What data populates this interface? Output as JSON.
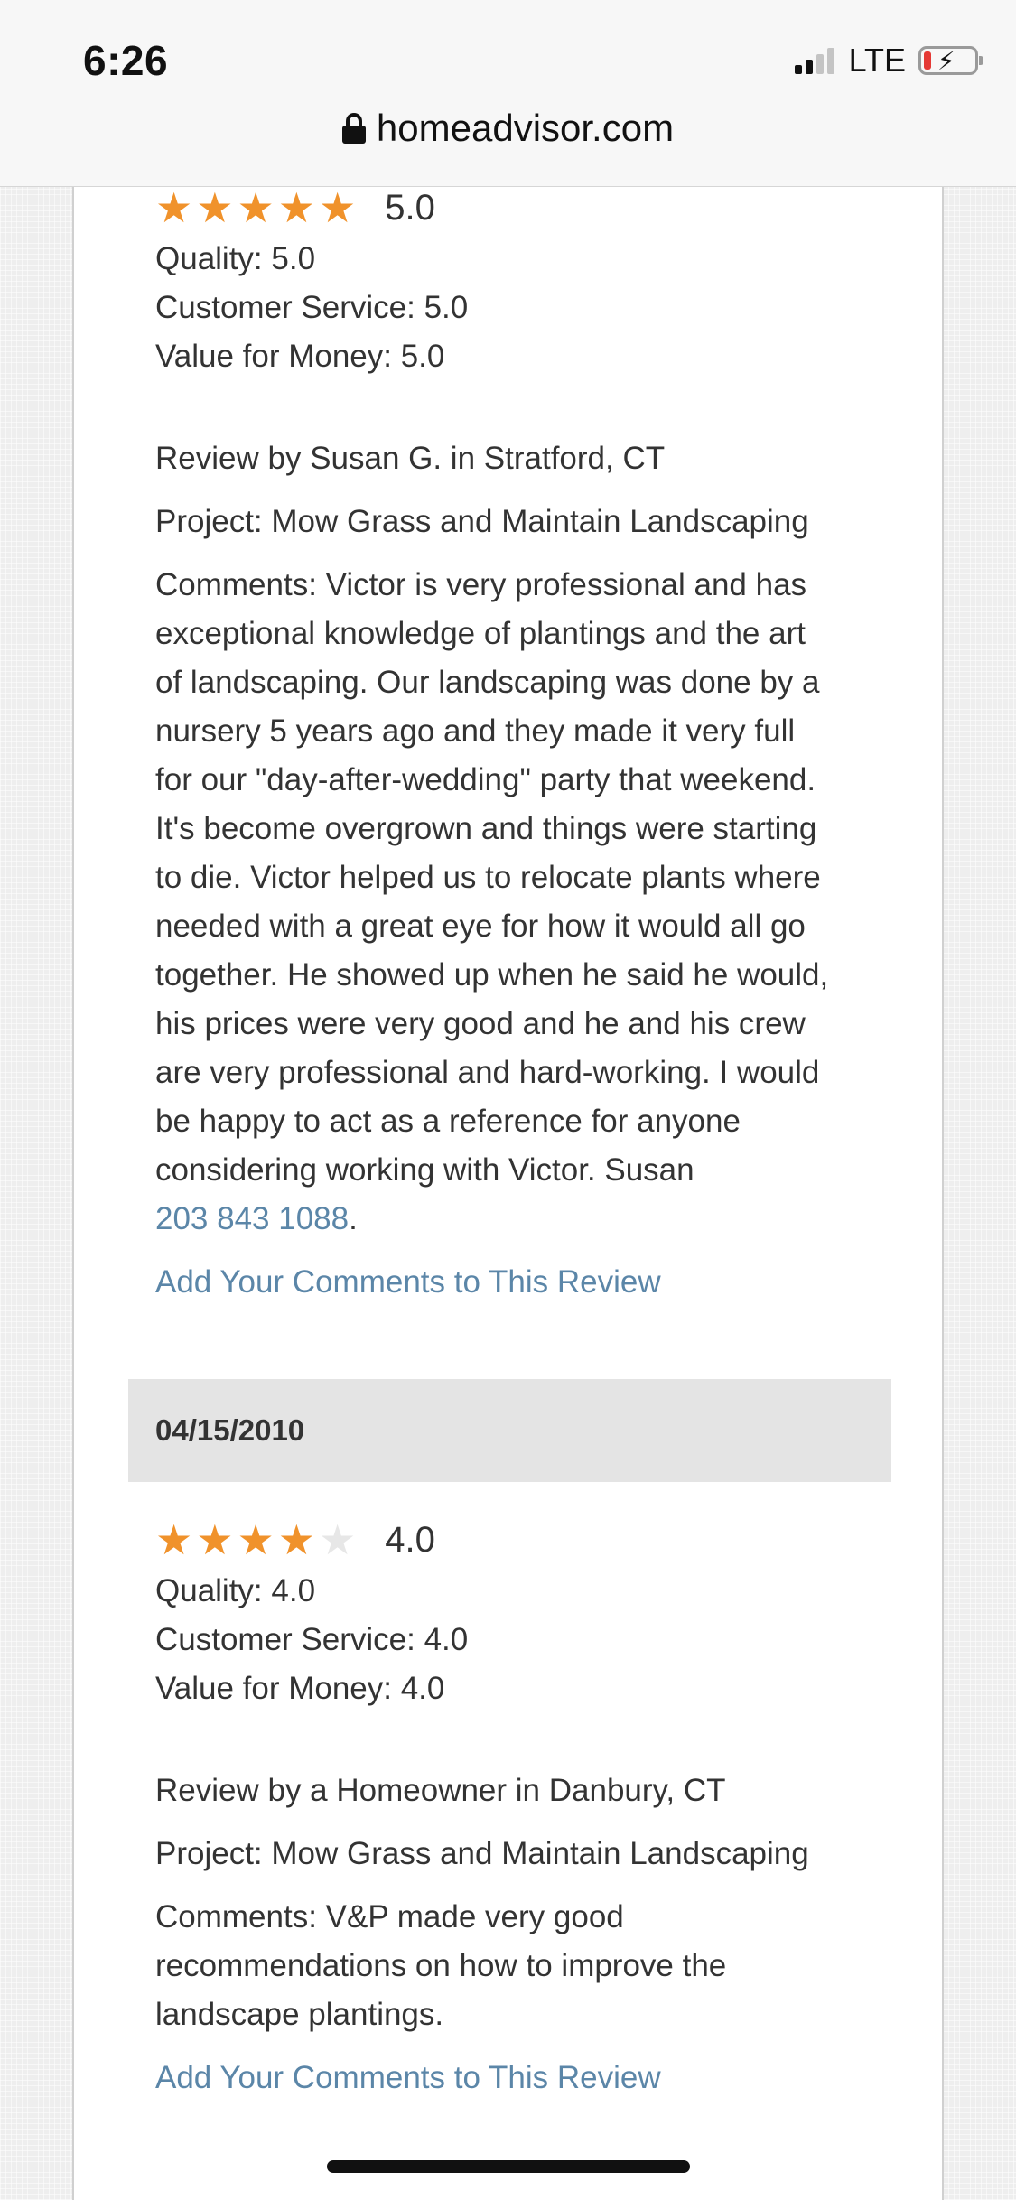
{
  "status_bar": {
    "time": "6:26",
    "network": "LTE",
    "battery_level": "low",
    "battery_color": "#e53935"
  },
  "url_bar": {
    "domain": "homeadvisor.com",
    "icon": "lock-icon"
  },
  "colors": {
    "star": "#f0922b",
    "link": "#5b86a8",
    "date_bar": "#e4e4e4"
  },
  "reviews": [
    {
      "stars_filled": 5,
      "stars_total": 5,
      "score": "5.0",
      "quality": "Quality: 5.0",
      "customer_service": "Customer Service: 5.0",
      "value_for_money": "Value for Money: 5.0",
      "reviewer": "Review by Susan G. in Stratford, CT",
      "project": "Project: Mow Grass and Maintain Landscaping",
      "comments_lines": [
        "Comments: Victor is very professional and has",
        "exceptional knowledge of plantings and the art",
        "of landscaping. Our landscaping was done by a",
        "nursery 5 years ago and they made it very full",
        "for our \"day-after-wedding\" party that weekend.",
        "It's become overgrown and things were starting",
        "to die. Victor helped us to relocate plants where",
        "needed with a great eye for how it would all go",
        "together. He showed up when he said he would,",
        "his prices were very good and he and his crew",
        "are very professional and hard-working. I would",
        "be happy to act as a reference for anyone",
        "considering working with Victor. Susan"
      ],
      "phone": "203 843 1088",
      "phone_suffix": ".",
      "add_comment": "Add Your Comments to This Review"
    },
    {
      "date": "04/15/2010",
      "stars_filled": 4,
      "stars_total": 5,
      "score": "4.0",
      "quality": "Quality: 4.0",
      "customer_service": "Customer Service: 4.0",
      "value_for_money": "Value for Money: 4.0",
      "reviewer": "Review by a Homeowner in Danbury, CT",
      "project": "Project: Mow Grass and Maintain Landscaping",
      "comments_lines": [
        "Comments: V&P made very good",
        "recommendations on how to improve the",
        "landscape plantings."
      ],
      "add_comment": "Add Your Comments to This Review"
    }
  ]
}
